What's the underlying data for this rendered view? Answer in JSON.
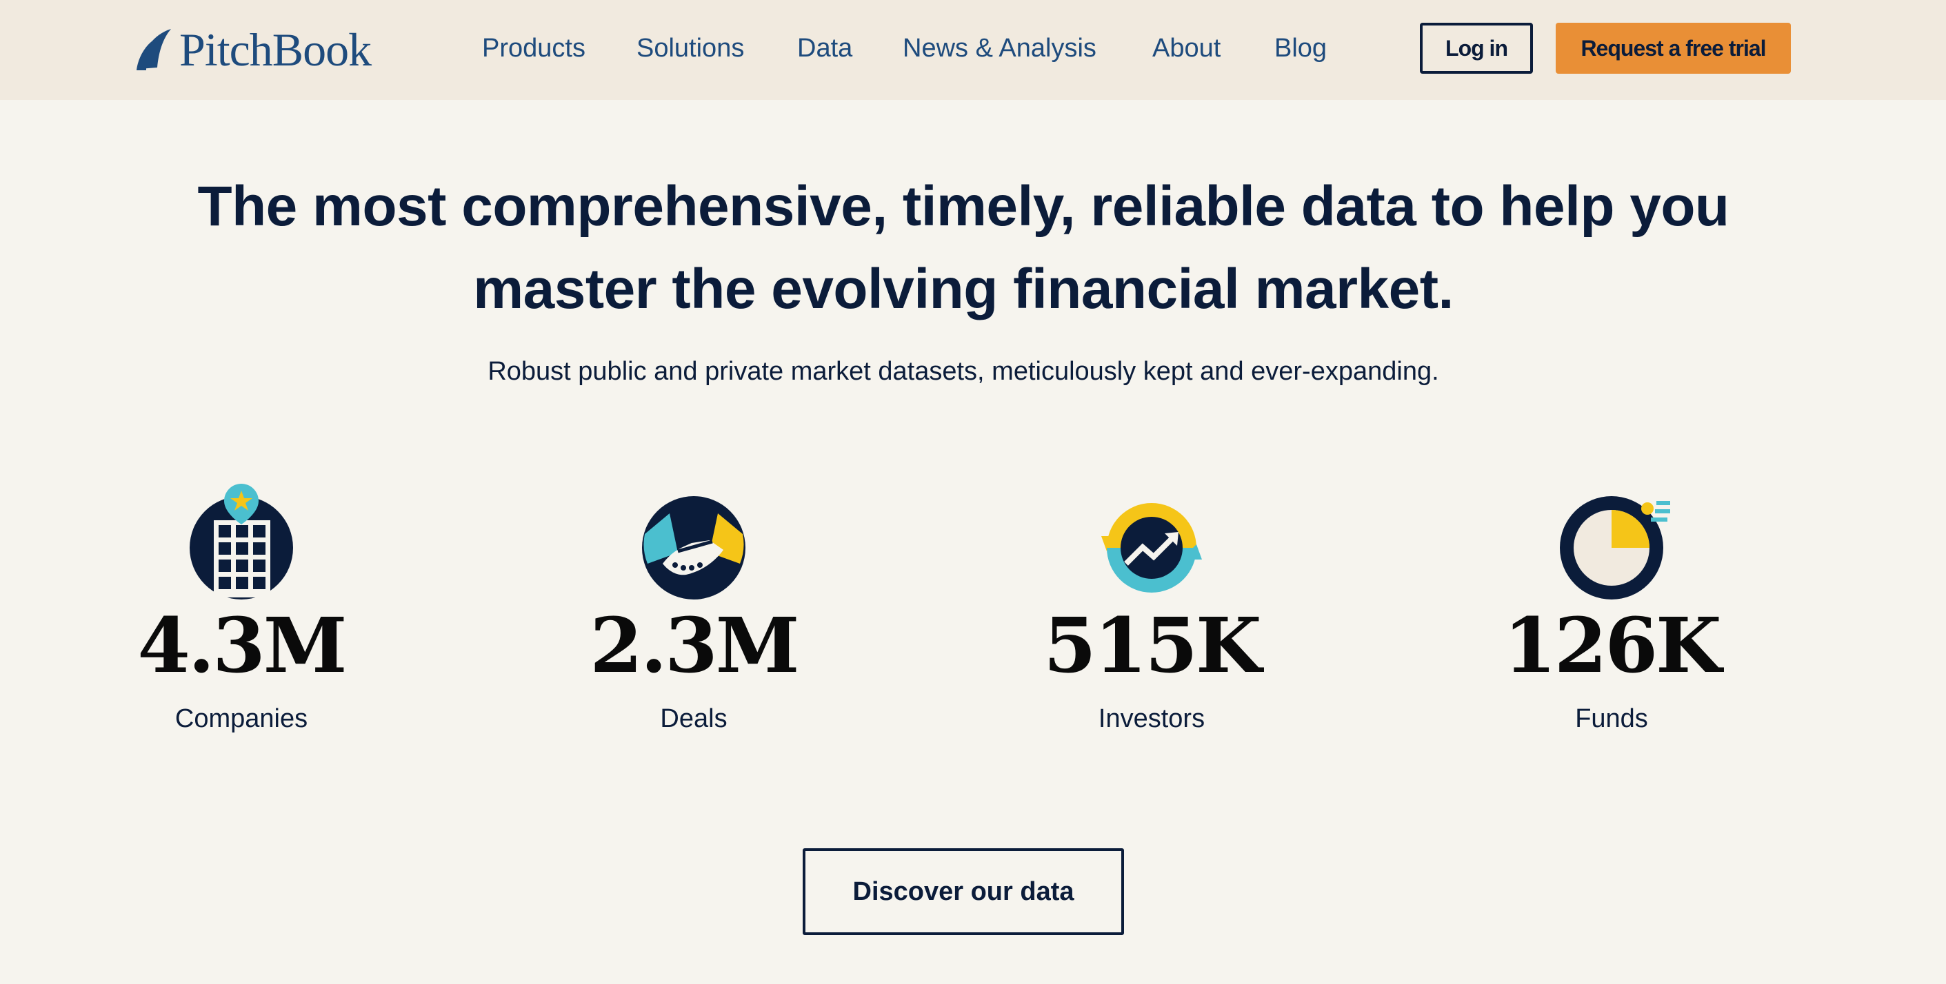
{
  "header": {
    "logo_text": "PitchBook",
    "nav": [
      "Products",
      "Solutions",
      "Data",
      "News & Analysis",
      "About",
      "Blog"
    ],
    "login_label": "Log in",
    "trial_label": "Request a free trial"
  },
  "hero": {
    "headline": "The most comprehensive, timely, reliable data to help you master the evolving financial market.",
    "subheadline": "Robust public and private market datasets, meticulously kept and ever-expanding."
  },
  "stats": [
    {
      "value": "4.3M",
      "label": "Companies",
      "icon": "building-icon"
    },
    {
      "value": "2.3M",
      "label": "Deals",
      "icon": "handshake-icon"
    },
    {
      "value": "515K",
      "label": "Investors",
      "icon": "growth-cycle-icon"
    },
    {
      "value": "126K",
      "label": "Funds",
      "icon": "pie-chart-icon"
    }
  ],
  "cta_label": "Discover our data",
  "colors": {
    "navy": "#0b1c3a",
    "brand_blue": "#1e4b7d",
    "orange": "#e98f36",
    "teal": "#4bbfcf",
    "yellow": "#f5c518",
    "header_bg": "#f1eadf",
    "page_bg": "#f6f4ee"
  }
}
